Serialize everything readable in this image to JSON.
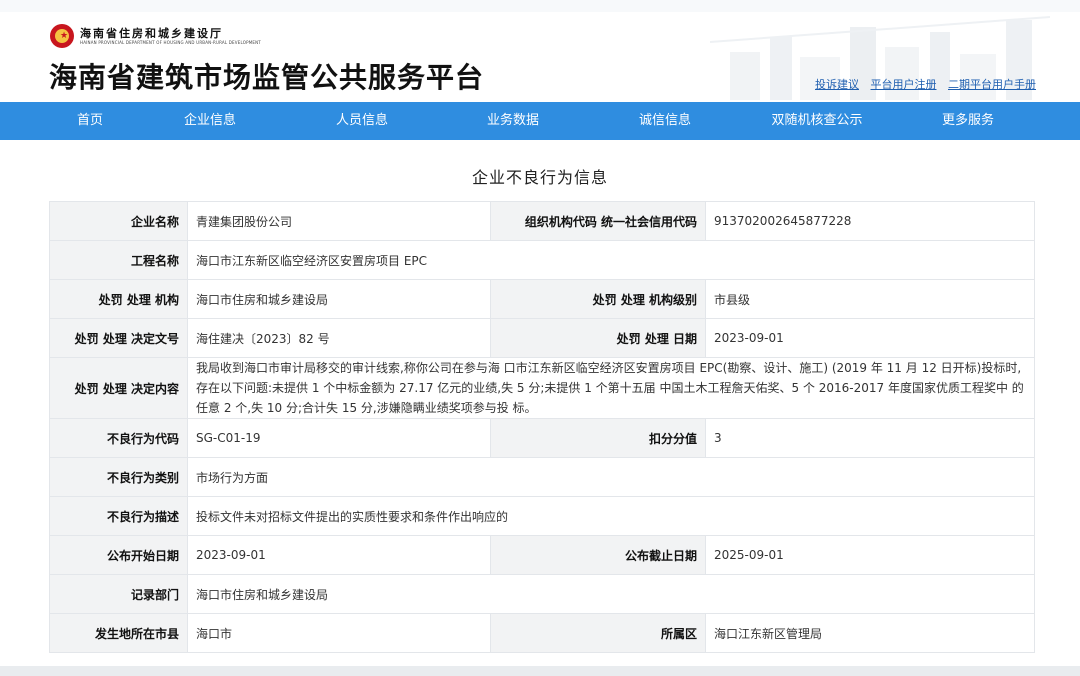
{
  "header": {
    "dept_name": "海南省住房和城乡建设厅",
    "dept_name_en": "HAINAN PROVINCIAL DEPARTMENT OF HOUSING AND URBAN-RURAL DEVELOPMENT",
    "site_title": "海南省建筑市场监管公共服务平台",
    "links": [
      "投诉建议",
      "平台用户注册",
      "二期平台用户手册"
    ]
  },
  "nav": [
    "首页",
    "企业信息",
    "人员信息",
    "业务数据",
    "诚信信息",
    "双随机核查公示",
    "更多服务"
  ],
  "page_title": "企业不良行为信息",
  "rows": [
    {
      "l1": "企业名称",
      "v1": "青建集团股份公司",
      "l2": "组织机构代码 统一社会信用代码",
      "v2": "913702002645877228"
    },
    {
      "l1": "工程名称",
      "v1": "海口市江东新区临空经济区安置房项目 EPC"
    },
    {
      "l1": "处罚 处理 机构",
      "v1": "海口市住房和城乡建设局",
      "l2": "处罚 处理 机构级别",
      "v2": "市县级"
    },
    {
      "l1": "处罚 处理 决定文号",
      "v1": "海住建决〔2023〕82 号",
      "l2": "处罚 处理 日期",
      "v2": "2023-09-01"
    },
    {
      "l1": "处罚 处理 决定内容",
      "v1": "我局收到海口市审计局移交的审计线索,称你公司在参与海 口市江东新区临空经济区安置房项目 EPC(勘察、设计、施工) (2019 年 11 月 12 日开标)投标时,存在以下问题:未提供 1 个中标金额为 27.17 亿元的业绩,失 5 分;未提供 1 个第十五届 中国土木工程詹天佑奖、5 个 2016-2017 年度国家优质工程奖中 的任意 2 个,失 10 分;合计失 15 分,涉嫌隐瞒业绩奖项参与投 标。"
    },
    {
      "l1": "不良行为代码",
      "v1": "SG-C01-19",
      "l2": "扣分分值",
      "v2": "3"
    },
    {
      "l1": "不良行为类别",
      "v1": "市场行为方面"
    },
    {
      "l1": "不良行为描述",
      "v1": "投标文件未对招标文件提出的实质性要求和条件作出响应的"
    },
    {
      "l1": "公布开始日期",
      "v1": "2023-09-01",
      "l2": "公布截止日期",
      "v2": "2025-09-01"
    },
    {
      "l1": "记录部门",
      "v1": "海口市住房和城乡建设局"
    },
    {
      "l1": "发生地所在市县",
      "v1": "海口市",
      "l2": "所属区",
      "v2": "海口江东新区管理局"
    }
  ]
}
